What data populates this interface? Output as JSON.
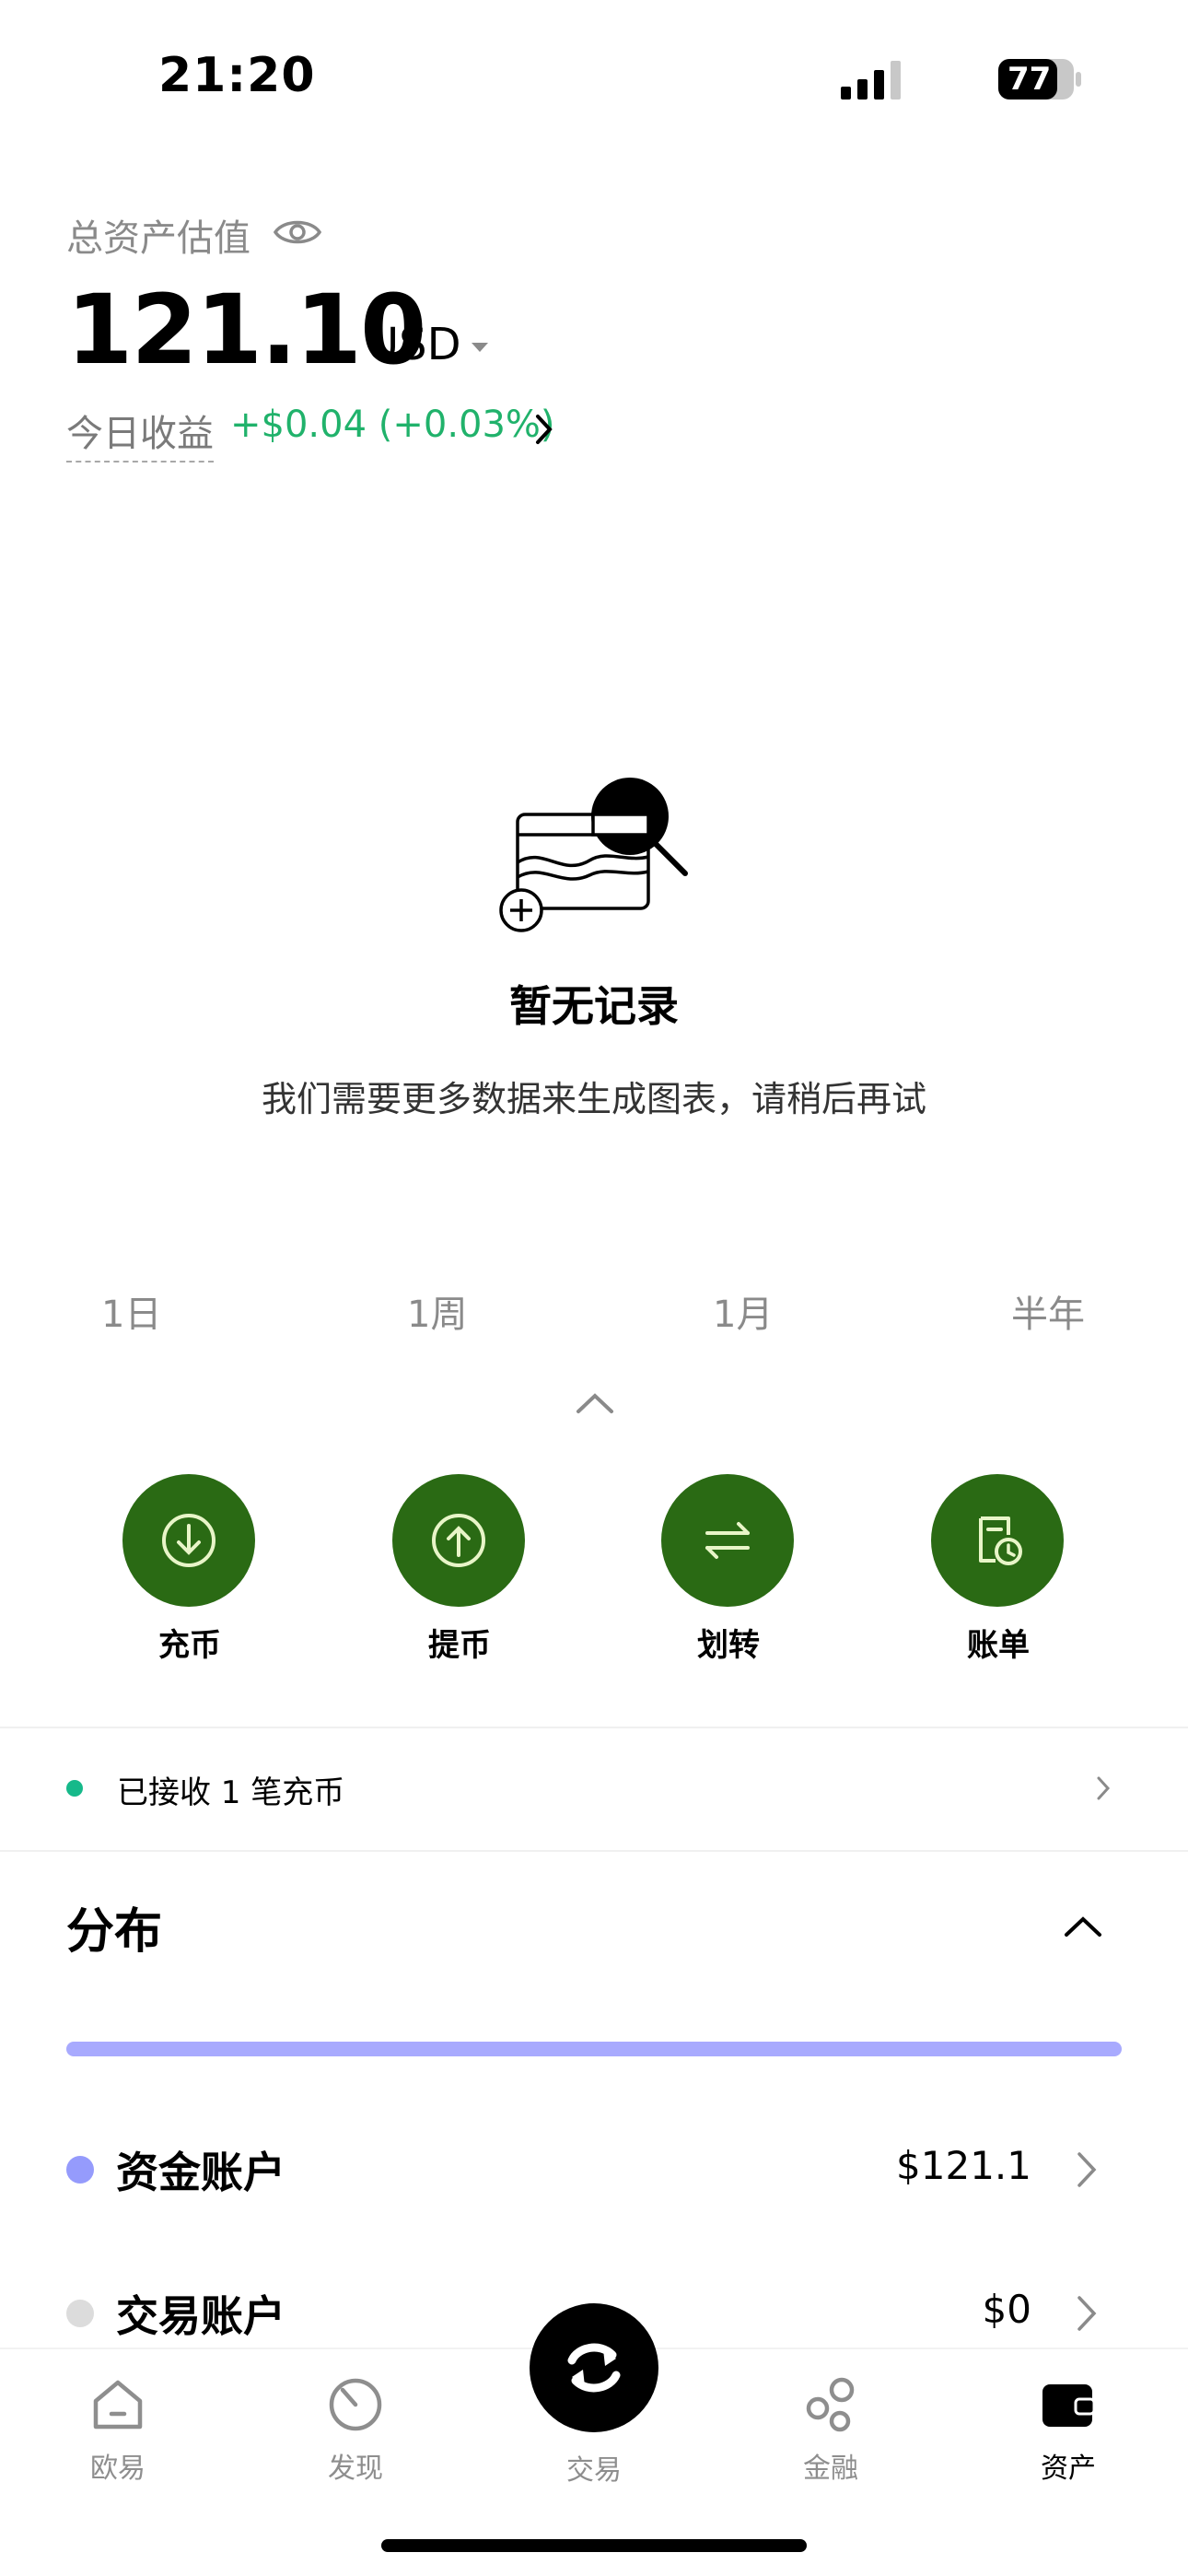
{
  "status_bar": {
    "time": "21:20",
    "battery": "77"
  },
  "header": {
    "asset_label": "总资产估值",
    "asset_value": "121.10",
    "currency": "USD",
    "pnl_label": "今日收益",
    "pnl_value": "+$0.04 (+0.03%)"
  },
  "empty_state": {
    "title": "暂无记录",
    "description": "我们需要更多数据来生成图表，请稍后再试"
  },
  "periods": [
    "1日",
    "1周",
    "1月",
    "半年"
  ],
  "actions": [
    {
      "label": "充币",
      "icon": "download-icon"
    },
    {
      "label": "提币",
      "icon": "upload-icon"
    },
    {
      "label": "划转",
      "icon": "transfer-icon"
    },
    {
      "label": "账单",
      "icon": "bill-icon"
    }
  ],
  "notice": {
    "text": "已接收 1 笔充币"
  },
  "distribution": {
    "title": "分布",
    "accounts": [
      {
        "name": "资金账户",
        "value": "$121.1",
        "color": "#959bfc"
      },
      {
        "name": "交易账户",
        "value": "$0",
        "color": "#dcdcdc"
      }
    ]
  },
  "tab_bar": {
    "items": [
      {
        "label": "欧易",
        "icon": "home-icon"
      },
      {
        "label": "发现",
        "icon": "discover-icon"
      },
      {
        "label": "交易",
        "icon": "swap-icon"
      },
      {
        "label": "金融",
        "icon": "finance-icon"
      },
      {
        "label": "资产",
        "icon": "wallet-icon"
      }
    ],
    "active": "资产"
  },
  "colors": {
    "accent_green": "#2a6a14",
    "profit": "#20b26b",
    "distribution_bar": "#a8aafe"
  }
}
